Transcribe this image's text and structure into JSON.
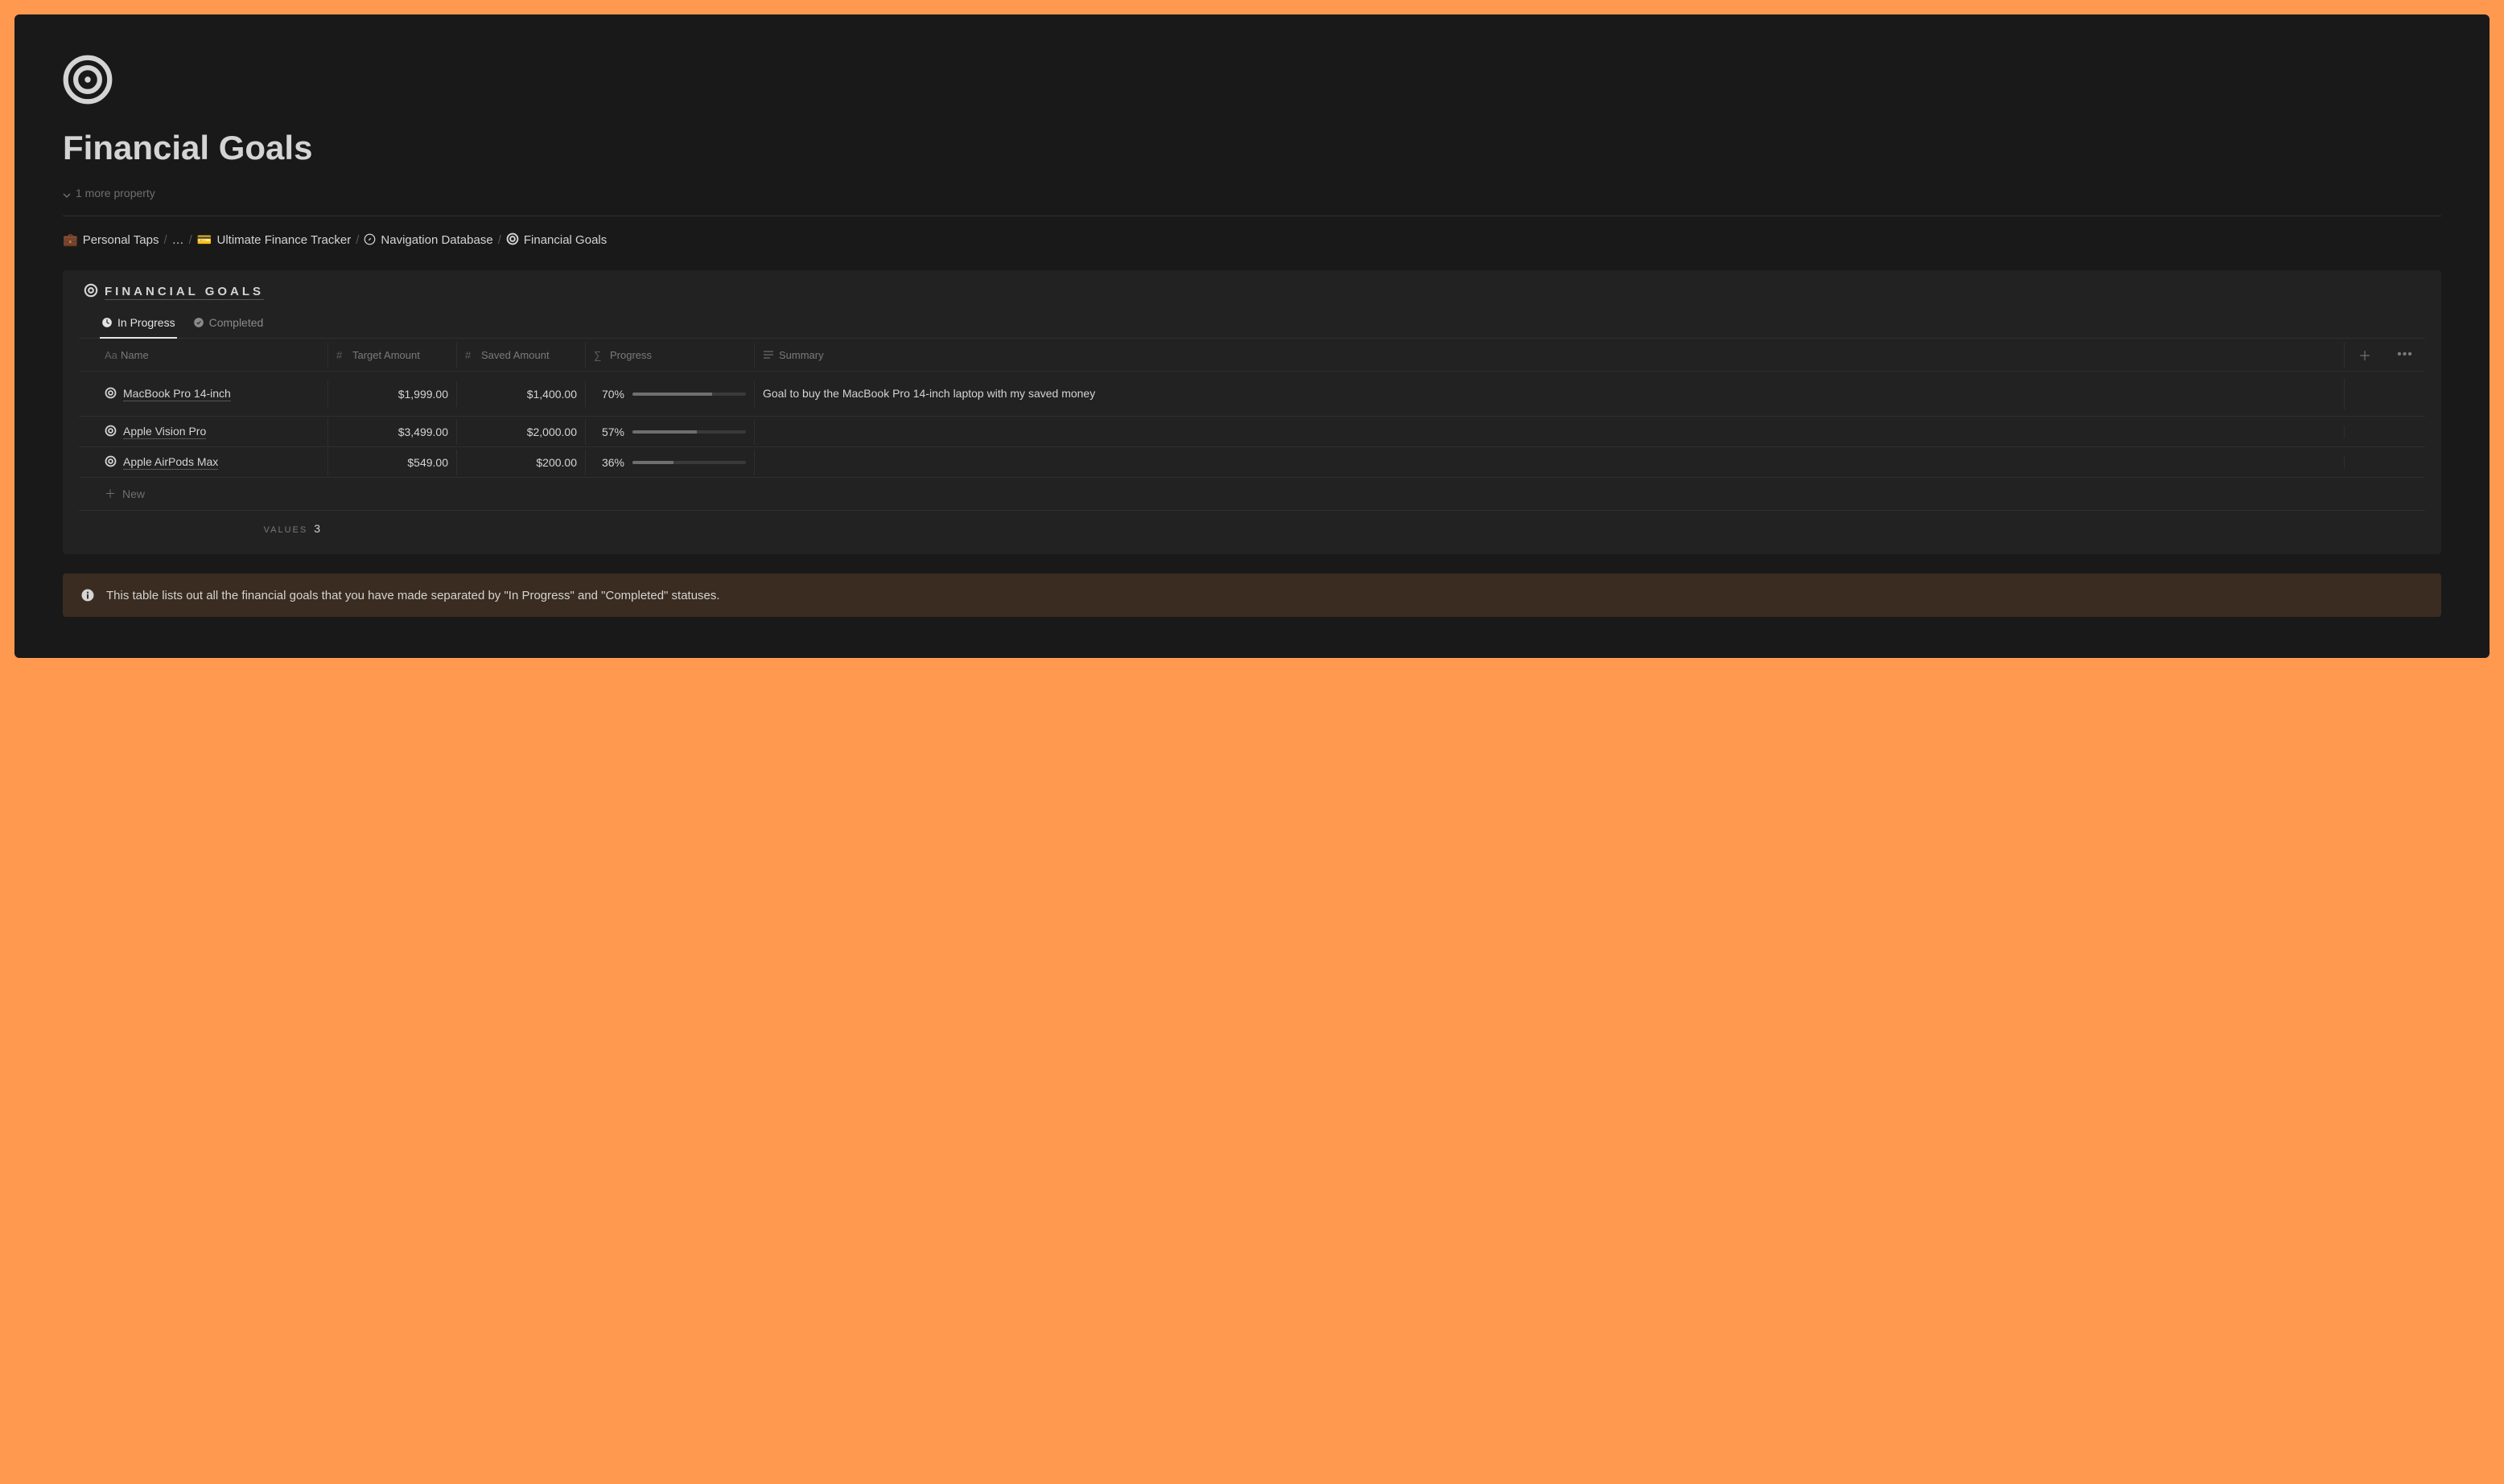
{
  "page": {
    "title": "Financial Goals",
    "more_property": "1 more property"
  },
  "breadcrumb": {
    "items": [
      {
        "icon": "💼",
        "label": "Personal Taps"
      },
      {
        "icon": "",
        "label": "…"
      },
      {
        "icon": "💳",
        "label": "Ultimate Finance Tracker"
      },
      {
        "icon": "🧭",
        "label": "Navigation Database"
      },
      {
        "icon": "🎯",
        "label": "Financial Goals"
      }
    ]
  },
  "database": {
    "title": "FINANCIAL GOALS",
    "tabs": [
      {
        "label": "In Progress",
        "icon": "clock",
        "active": true
      },
      {
        "label": "Completed",
        "icon": "check",
        "active": false
      }
    ],
    "columns": {
      "name": "Name",
      "target": "Target Amount",
      "saved": "Saved Amount",
      "progress": "Progress",
      "summary": "Summary"
    },
    "rows": [
      {
        "name": "MacBook Pro 14-inch",
        "target": "$1,999.00",
        "saved": "$1,400.00",
        "pct_label": "70%",
        "pct": 70,
        "summary": "Goal to buy the MacBook Pro 14-inch laptop with my saved money"
      },
      {
        "name": "Apple Vision Pro",
        "target": "$3,499.00",
        "saved": "$2,000.00",
        "pct_label": "57%",
        "pct": 57,
        "summary": ""
      },
      {
        "name": "Apple AirPods Max",
        "target": "$549.00",
        "saved": "$200.00",
        "pct_label": "36%",
        "pct": 36,
        "summary": ""
      }
    ],
    "new_label": "New",
    "values_label": "VALUES",
    "values_count": "3"
  },
  "callout": {
    "text": "This table lists out all the financial goals that you have made separated by \"In Progress\" and \"Completed\" statuses."
  }
}
